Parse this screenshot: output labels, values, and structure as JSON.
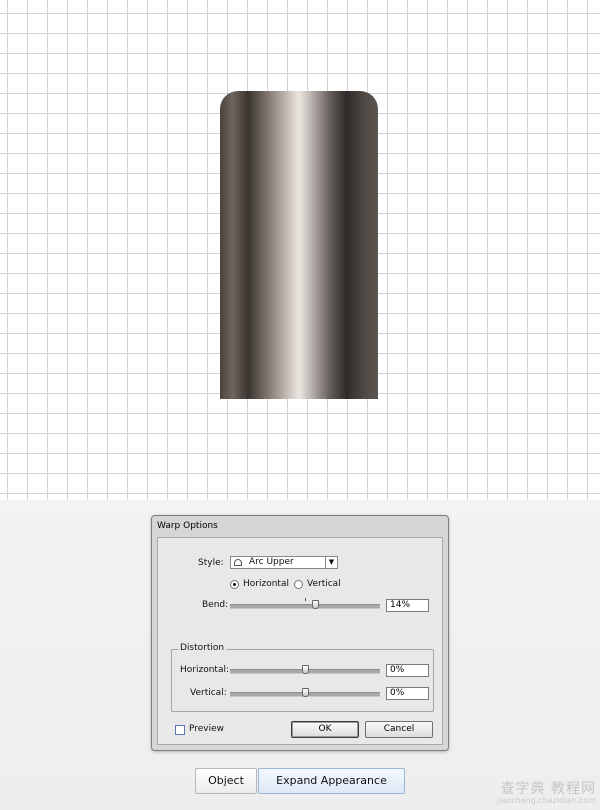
{
  "dialog": {
    "title": "Warp Options",
    "style_label": "Style:",
    "style_value": "Arc Upper",
    "style_icon": "arc-upper-icon",
    "orientation_options": [
      {
        "label": "Horizontal",
        "selected": true
      },
      {
        "label": "Vertical",
        "selected": false
      }
    ],
    "bend_label": "Bend:",
    "bend_value": "14%",
    "distortion_label": "Distortion",
    "horizontal_label": "Horizontal:",
    "horizontal_value": "0%",
    "vertical_label": "Vertical:",
    "vertical_value": "0%",
    "preview_label": "Preview",
    "preview_checked": false,
    "ok_label": "OK",
    "cancel_label": "Cancel"
  },
  "bottom_bar": {
    "object_label": "Object",
    "expand_label": "Expand Appearance"
  },
  "watermark": {
    "main": "查字典 教程网",
    "sub": "jiaocheng.chazidian.com"
  }
}
